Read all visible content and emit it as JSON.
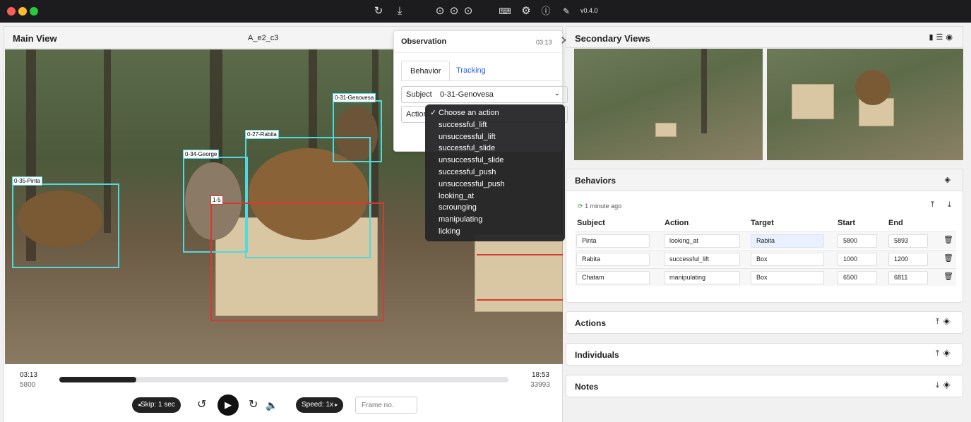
{
  "app": {
    "version": "v0.4.0"
  },
  "main_view": {
    "title": "Main View",
    "video_name": "A_e2_c3",
    "bboxes": [
      {
        "label": "0-31-Genovesa"
      },
      {
        "label": "0-27-Rabita"
      },
      {
        "label": "0-34-George"
      },
      {
        "label": "0-35-Pinta"
      },
      {
        "label": "1-5"
      }
    ],
    "playback": {
      "current_time": "03:13",
      "current_frame": "5800",
      "end_time": "18:53",
      "end_frame": "33993",
      "progress_fraction": 0.171,
      "skip_label": "Skip: 1 sec",
      "speed_label": "Speed: 1x",
      "frame_placeholder": "Frame no."
    }
  },
  "observation": {
    "title": "Observation",
    "time": "03:13",
    "tabs": [
      "Behavior",
      "Tracking"
    ],
    "subject_label": "Subject",
    "subject_value": "0-31-Genovesa",
    "action_label": "Action",
    "action_options": [
      "Choose an action",
      "successful_lift",
      "unsuccessful_lift",
      "successful_slide",
      "unsuccessful_slide",
      "successful_push",
      "unsuccessful_push",
      "looking_at",
      "scrounging",
      "manipulating",
      "licking"
    ],
    "action_selected_index": 0
  },
  "secondary_views": {
    "title": "Secondary Views"
  },
  "behaviors": {
    "title": "Behaviors",
    "sync_text": "1 minute ago",
    "columns": [
      "Subject",
      "Action",
      "Target",
      "Start",
      "End"
    ],
    "rows": [
      {
        "subject": "Pinta",
        "action": "looking_at",
        "target": "Rabita",
        "start": "5800",
        "end": "5893"
      },
      {
        "subject": "Rabita",
        "action": "successful_lift",
        "target": "Box",
        "start": "1000",
        "end": "1200"
      },
      {
        "subject": "Chatam",
        "action": "manipulating",
        "target": "Box",
        "start": "6500",
        "end": "6811"
      }
    ]
  },
  "sections": {
    "actions": "Actions",
    "individuals": "Individuals",
    "notes": "Notes"
  }
}
